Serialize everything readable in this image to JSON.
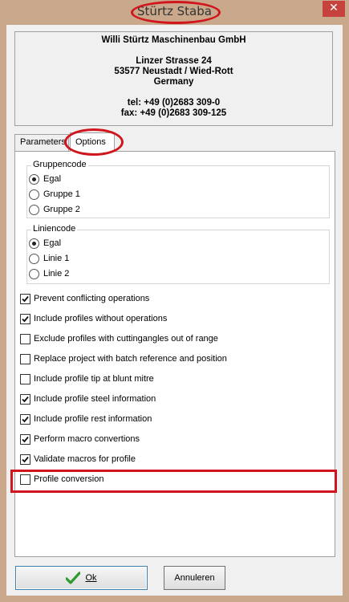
{
  "window": {
    "title": "Stürtz Staba",
    "close_glyph": "✕"
  },
  "address": {
    "lines": [
      "Willi Stürtz Maschinenbau GmbH",
      "",
      "Linzer Strasse 24",
      "53577 Neustadt / Wied-Rott",
      "Germany",
      "",
      "tel: +49 (0)2683 309-0",
      "fax: +49 (0)2683 309-125"
    ]
  },
  "tabs": [
    {
      "label": "Parameters",
      "active": false
    },
    {
      "label": "Options",
      "active": true
    }
  ],
  "groups": {
    "gruppencode": {
      "title": "Gruppencode",
      "options": [
        {
          "label": "Egal",
          "selected": true
        },
        {
          "label": "Gruppe 1",
          "selected": false
        },
        {
          "label": "Gruppe 2",
          "selected": false
        }
      ]
    },
    "liniencode": {
      "title": "Liniencode",
      "options": [
        {
          "label": "Egal",
          "selected": true
        },
        {
          "label": "Linie 1",
          "selected": false
        },
        {
          "label": "Linie 2",
          "selected": false
        }
      ]
    }
  },
  "checkboxes": [
    {
      "label": "Prevent conflicting operations",
      "checked": true
    },
    {
      "label": "Include profiles without operations",
      "checked": true
    },
    {
      "label": "Exclude profiles with cuttingangles out of range",
      "checked": false
    },
    {
      "label": "Replace project with batch reference and position",
      "checked": false
    },
    {
      "label": "Include profile tip at blunt mitre",
      "checked": false
    },
    {
      "label": "Include profile steel information",
      "checked": true
    },
    {
      "label": "Include profile rest information",
      "checked": true
    },
    {
      "label": "Perform macro convertions",
      "checked": true
    },
    {
      "label": "Validate macros for profile",
      "checked": true
    },
    {
      "label": "Profile conversion",
      "checked": false
    }
  ],
  "buttons": {
    "ok_label": "Ok",
    "cancel_label": "Annuleren"
  },
  "colors": {
    "frame": "#c9a88b",
    "annotation": "#d0161c",
    "ok_icon": "#2f9a2f"
  }
}
